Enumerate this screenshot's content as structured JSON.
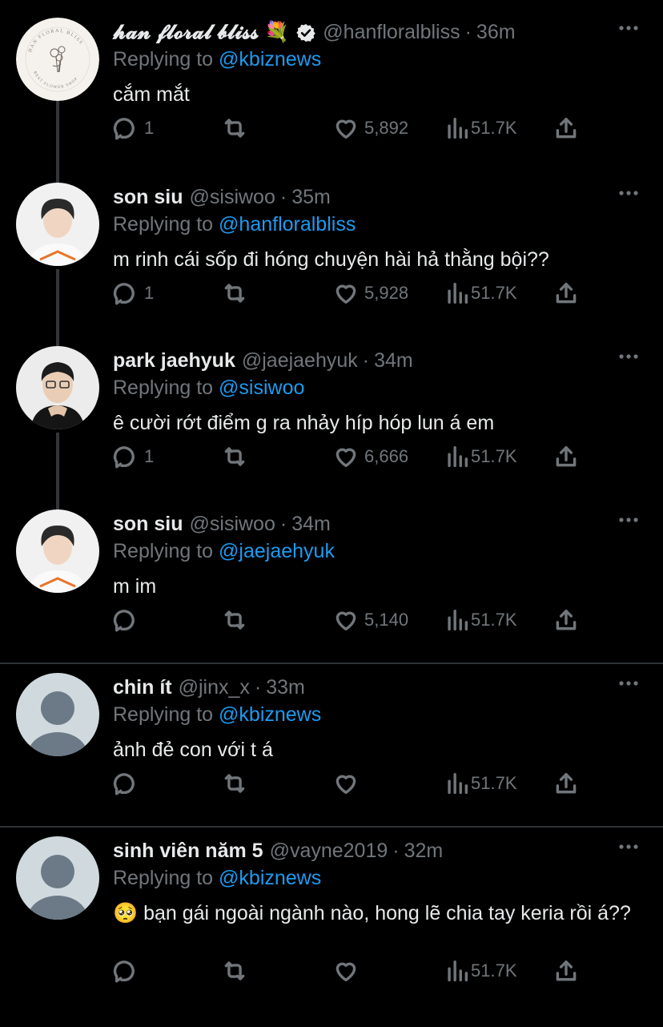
{
  "tweets": [
    {
      "name": "𝓱𝓪𝓷 𝓯𝓵𝓸𝓻𝓪𝓵 𝓫𝓵𝓲𝓼𝓼 💐",
      "verified": true,
      "handle": "@hanfloralbliss",
      "time": "36m",
      "replying_prefix": "Replying to",
      "replying_to": "@kbiznews",
      "text": "cắm mắt",
      "replies": "1",
      "retweets": "",
      "likes": "5,892",
      "views": "51.7K",
      "avatar": "floral-logo",
      "avatar_text_top": "HAN FLORAL BLISS",
      "avatar_text_bottom": "BEST FLOWER SHOP"
    },
    {
      "name": "son siu",
      "handle": "@sisiwoo",
      "time": "35m",
      "replying_prefix": "Replying to",
      "replying_to": "@hanfloralbliss",
      "text": "m rinh cái sốp đi hóng chuyện hài hả thằng bội??",
      "replies": "1",
      "retweets": "",
      "likes": "5,928",
      "views": "51.7K",
      "avatar": "photo-boy-white"
    },
    {
      "name": "park jaehyuk",
      "handle": "@jaejaehyuk",
      "time": "34m",
      "replying_prefix": "Replying to",
      "replying_to": "@sisiwoo",
      "text": "ê cười rớt điểm g ra nhảy híp hóp lun á em",
      "replies": "1",
      "retweets": "",
      "likes": "6,666",
      "views": "51.7K",
      "avatar": "photo-glasses-black"
    },
    {
      "name": "son siu",
      "handle": "@sisiwoo",
      "time": "34m",
      "replying_prefix": "Replying to",
      "replying_to": "@jaejaehyuk",
      "text": "m im",
      "replies": "",
      "retweets": "",
      "likes": "5,140",
      "views": "51.7K",
      "avatar": "photo-boy-white"
    },
    {
      "name": "chin ít",
      "handle": "@jinx_x",
      "time": "33m",
      "replying_prefix": "Replying to",
      "replying_to": "@kbiznews",
      "text": "ảnh đẻ con với t á",
      "replies": "",
      "retweets": "",
      "likes": "",
      "views": "51.7K",
      "avatar": "default-avatar"
    },
    {
      "name": "sinh viên năm 5",
      "handle": "@vayne2019",
      "time": "32m",
      "replying_prefix": "Replying to",
      "replying_to": "@kbiznews",
      "text": "🥺 bạn gái ngoài ngành nào, hong lẽ chia tay keria rồi á??",
      "replies": "",
      "retweets": "",
      "likes": "",
      "views": "51.7K",
      "avatar": "default-avatar"
    }
  ],
  "colors": {
    "background": "#000000",
    "text": "#e7e9ea",
    "muted": "#71767b",
    "link": "#1d9bf0",
    "divider": "#2f3336"
  }
}
